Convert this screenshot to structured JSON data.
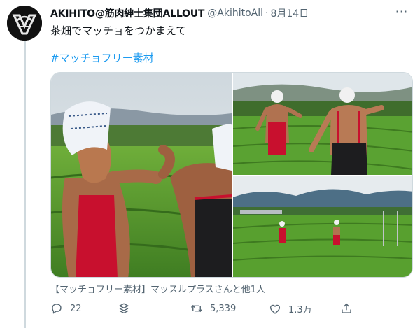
{
  "tweet": {
    "display_name": "AKIHITO@筋肉紳士集団ALLOUT",
    "handle": "@AkihitoAll",
    "separator": "·",
    "date": "8月14日",
    "more_label": "···",
    "text": "茶畑でマッチョをつかまえて",
    "hashtag": "#マッチョフリー素材",
    "media_caption": "【マッチョフリー素材】マッスルプラスさんと他1人"
  },
  "actions": {
    "reply_count": "22",
    "retweet_count": "5,339",
    "like_count": "1.3万"
  },
  "colors": {
    "link": "#1d9bf0",
    "secondary_text": "#536471",
    "primary_text": "#0f1419",
    "tea_green": "#5a9a2e",
    "apron_red": "#c8102e"
  },
  "icons": [
    "reply-icon",
    "analytics-stack-icon",
    "retweet-icon",
    "like-icon",
    "share-icon",
    "more-icon"
  ]
}
